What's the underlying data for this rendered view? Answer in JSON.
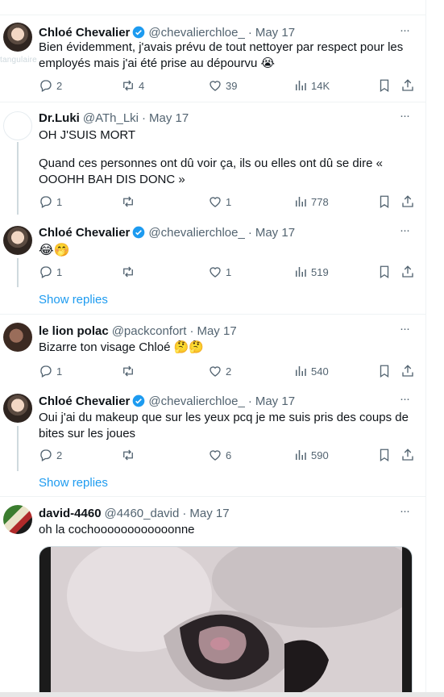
{
  "ghost_text": "tangulaire",
  "tweets": [
    {
      "name": "Chloé Chevalier",
      "handle": "@chevalierchloe_",
      "date": "May 17",
      "text": "Bien évidemment, j'avais prévu de tout nettoyer par respect pour les employés mais j'ai été prise au dépourvu 😭",
      "replies": "2",
      "retweets": "4",
      "likes": "39",
      "views": "14K"
    },
    {
      "name": "Dr.Luki",
      "handle": "@ATh_Lki",
      "date": "May 17",
      "text_line1": "OH J'SUIS MORT",
      "text_line2": "Quand ces personnes ont dû voir ça, ils ou elles ont dû se dire « OOOHH BAH DIS DONC »",
      "replies": "1",
      "retweets": "",
      "likes": "1",
      "views": "778"
    },
    {
      "name": "Chloé Chevalier",
      "handle": "@chevalierchloe_",
      "date": "May 17",
      "text": "😂🤭",
      "replies": "1",
      "retweets": "",
      "likes": "1",
      "views": "519",
      "show_replies": "Show replies"
    },
    {
      "name": "le lion polac",
      "handle": "@packconfort",
      "date": "May 17",
      "text": "Bizarre ton visage Chloé 🤔🤔",
      "replies": "1",
      "retweets": "",
      "likes": "2",
      "views": "540"
    },
    {
      "name": "Chloé Chevalier",
      "handle": "@chevalierchloe_",
      "date": "May 17",
      "text": "Oui j'ai du makeup que sur les yeux pcq je me suis pris des coups de bites sur les joues",
      "replies": "2",
      "retweets": "",
      "likes": "6",
      "views": "590",
      "show_replies": "Show replies"
    },
    {
      "name": "david-4460",
      "handle": "@4460_david",
      "date": "May 17",
      "text": "oh la cochoooooooooooonne"
    }
  ],
  "separator": "·",
  "more_label": "···",
  "colors": {
    "accent": "#1d9bf0",
    "muted": "#536471",
    "text": "#0f1419",
    "border": "#eff3f4"
  }
}
